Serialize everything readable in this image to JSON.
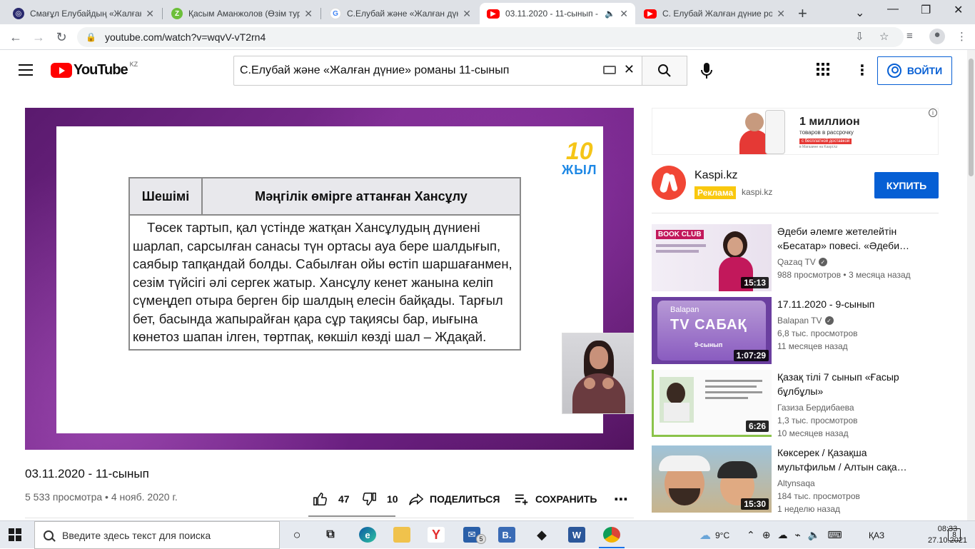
{
  "browser": {
    "tabs": [
      {
        "title": "Смағұл Елубайдың «Жалған",
        "favicon": "bilim-icon",
        "color": "#2a2a6e",
        "active": false
      },
      {
        "title": "Қасым Аманжолов (Өзім тур",
        "favicon": "z-icon",
        "color": "#6cbf3a",
        "active": false
      },
      {
        "title": "С.Елубай және «Жалған дүни",
        "favicon": "google-icon",
        "color": "#4285f4",
        "active": false
      },
      {
        "title": "03.11.2020 - 11-сынып -",
        "favicon": "youtube-icon",
        "color": "#ff0000",
        "active": true
      },
      {
        "title": "С. Елубай Жалған дүние ром",
        "favicon": "youtube-icon",
        "color": "#ff0000",
        "active": false
      }
    ],
    "url": "youtube.com/watch?v=wqvV-vT2rn4"
  },
  "header": {
    "logo_text": "YouTube",
    "country": "KZ",
    "search_value": "С.Елубай және «Жалған дүние» романы 11-сынып",
    "login_label": "ВОЙТИ"
  },
  "video": {
    "badge_number": "10",
    "badge_word": "ЖЫЛ",
    "table_head_left": "Шешімі",
    "table_head_right": "Мәңгілік өмірге аттанған Хансұлу",
    "table_body": "Төсек тартып, қал үстінде жатқан Хансұлудың дүниені шарлап, сарсылған санасы түн ортасы ауа бере шалдығып, саябыр тапқандай болды. Сабылған ойы өстіп шаршағанмен, сезім түйсігі әлі сергек жатыр. Хансұлу кенет жанына келіп сүмеңдеп отыра берген бір шалдың елесін байқады. Тарғыл бет, басында жапырайған қара сұр тақиясы бар, иығына көнетоз шапан ілген, төртпақ, көкшіл көзді шал – Ждақай.",
    "title": "03.11.2020 - 11-сынып",
    "info": "5 533 просмотра • 4 нояб. 2020 г.",
    "likes": "47",
    "dislikes": "10",
    "share_label": "ПОДЕЛИТЬСЯ",
    "save_label": "СОХРАНИТЬ"
  },
  "ad": {
    "banner_headline": "1 миллион",
    "banner_sub": "товаров в рассрочку",
    "banner_pill": "с бесплатной доставкой",
    "banner_fine": "в Магазине на Kaspi.kz",
    "advertiser": "Kaspi.kz",
    "tag": "Реклама",
    "domain": "kaspi.kz",
    "cta": "КУПИТЬ"
  },
  "recommendations": [
    {
      "title": "Әдеби әлемге жетелейтін «Бесатар» повесі. «Әдеби…",
      "channel": "Qazaq TV",
      "verified": true,
      "views": "988 просмотров",
      "age": "3 месяца назад",
      "duration": "15:13",
      "thumb_text": "BOOK CLUB",
      "layout": "inline"
    },
    {
      "title": "17.11.2020 - 9-сынып",
      "channel": "Balapan TV",
      "verified": true,
      "views": "6,8 тыс. просмотров",
      "age": "11 месяцев назад",
      "duration": "1:07:29",
      "thumb_text": "TV САБАҚ",
      "thumb_sub": "9-сынып",
      "thumb_brand": "Balapan",
      "layout": "split"
    },
    {
      "title": "Қазақ тілі 7 сынып «Ғасыр бұлбұлы»",
      "channel": "Газиза Бердибаева",
      "verified": false,
      "views": "1,3 тыс. просмотров",
      "age": "10 месяцев назад",
      "duration": "6:26",
      "layout": "split"
    },
    {
      "title": "Көксерек / Қазақша мультфильм / Алтын сақа…",
      "channel": "Altynsaqa",
      "verified": false,
      "views": "184 тыс. просмотров",
      "age": "1 неделю назад",
      "duration": "15:30",
      "layout": "split"
    }
  ],
  "taskbar": {
    "search_placeholder": "Введите здесь текст для поиска",
    "mail_badge": "5",
    "weather": "9°C",
    "language": "ҚАЗ",
    "time": "08:33",
    "date": "27.10.2021",
    "notification_count": "8"
  }
}
